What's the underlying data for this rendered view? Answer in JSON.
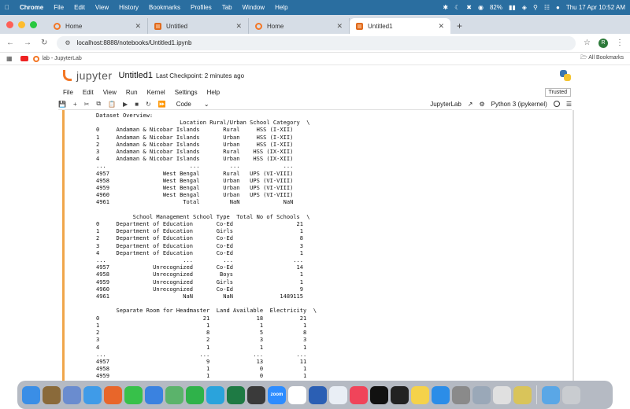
{
  "macos_menubar": {
    "app_name": "Chrome",
    "menus": [
      "File",
      "Edit",
      "View",
      "History",
      "Bookmarks",
      "Profiles",
      "Tab",
      "Window",
      "Help"
    ],
    "battery": "82%",
    "datetime": "Thu 17 Apr  10:52 AM"
  },
  "browser": {
    "tabs": [
      {
        "title": "Home",
        "icon": "jupyter-icon",
        "active": false
      },
      {
        "title": "Untitled",
        "icon": "notebook-icon",
        "active": false
      },
      {
        "title": "Home",
        "icon": "jupyter-icon",
        "active": false
      },
      {
        "title": "Untitled1",
        "icon": "notebook-icon",
        "active": true
      }
    ],
    "url": "localhost:8888/notebooks/Untitled1.ipynb",
    "profile_initial": "R",
    "bookmarks": [
      {
        "label": "",
        "icon": "youtube-icon"
      },
      {
        "label": "lab - JupyterLab",
        "icon": "jupyter-icon"
      }
    ],
    "all_bookmarks": "All Bookmarks"
  },
  "jupyter": {
    "logo_text": "jupyter",
    "notebook_title": "Untitled1",
    "checkpoint": "Last Checkpoint: 2 minutes ago",
    "menu": [
      "File",
      "Edit",
      "View",
      "Run",
      "Kernel",
      "Settings",
      "Help"
    ],
    "trusted": "Trusted",
    "cell_type": "Code",
    "jupyterlab_link": "JupyterLab",
    "kernel": "Python 3 (ipykernel)"
  },
  "output_lines": [
    "Dataset Overview:",
    "                         Location Rural/Urban School Category  \\",
    "0     Andaman & Nicobar Islands       Rural     HSS (I-XII)",
    "1     Andaman & Nicobar Islands       Urban     HSS (I-XII)",
    "2     Andaman & Nicobar Islands       Urban     HSS (I-XII)",
    "3     Andaman & Nicobar Islands       Rural    HSS (IX-XII)",
    "4     Andaman & Nicobar Islands       Urban    HSS (IX-XII)",
    "...                         ...         ...             ...",
    "4957                West Bengal       Rural   UPS (VI-VIII)",
    "4958                West Bengal       Urban   UPS (VI-VIII)",
    "4959                West Bengal       Urban   UPS (VI-VIII)",
    "4960                West Bengal       Urban   UPS (VI-VIII)",
    "4961                      Total         NaN             NaN",
    "",
    "           School Management School Type  Total No of Schools  \\",
    "0     Department of Education       Co-Ed                   21",
    "1     Department of Education       Girls                    1",
    "2     Department of Education       Co-Ed                    8",
    "3     Department of Education       Co-Ed                    3",
    "4     Department of Education       Co-Ed                    1",
    "...                       ...         ...                  ...",
    "4957             Unrecognized       Co-Ed                   14",
    "4958             Unrecognized        Boys                    1",
    "4959             Unrecognized       Girls                    1",
    "4960             Unrecognized       Co-Ed                    9",
    "4961                      NaN         NaN              1489115",
    "",
    "      Separate Room for Headmaster  Land Available  Electricity  \\",
    "0                               21              18           21",
    "1                                1               1            1",
    "2                                8               5            8",
    "3                                2               3            3",
    "4                                1               1            1",
    "...                            ...             ...          ...",
    "4957                             9              13           11",
    "4958                             1               0            1",
    "4959                             1               0            1"
  ],
  "dock_apps": [
    {
      "name": "finder-icon",
      "color": "#3a8ee6",
      "label": ""
    },
    {
      "name": "launchpad-icon",
      "color": "#8a6a3a",
      "label": ""
    },
    {
      "name": "apps-grid-icon",
      "color": "#6a8ccf",
      "label": ""
    },
    {
      "name": "safari-icon",
      "color": "#3f9be8",
      "label": ""
    },
    {
      "name": "firefox-icon",
      "color": "#e8662a",
      "label": ""
    },
    {
      "name": "messages-icon",
      "color": "#37c14a",
      "label": ""
    },
    {
      "name": "mail-icon",
      "color": "#3a82e0",
      "label": ""
    },
    {
      "name": "maps-icon",
      "color": "#5bb36b",
      "label": ""
    },
    {
      "name": "facetime-icon",
      "color": "#2fb24a",
      "label": ""
    },
    {
      "name": "telegram-icon",
      "color": "#2aa3dc",
      "label": ""
    },
    {
      "name": "excel-icon",
      "color": "#1e7a44",
      "label": ""
    },
    {
      "name": "terminal-alt-icon",
      "color": "#3a3a3a",
      "label": ""
    },
    {
      "name": "zoom-icon",
      "color": "#2d8cff",
      "label": "zoom"
    },
    {
      "name": "calendar-icon",
      "color": "#ffffff",
      "label": ""
    },
    {
      "name": "word-icon",
      "color": "#2b5fb4",
      "label": ""
    },
    {
      "name": "freeform-icon",
      "color": "#e9eef5",
      "label": ""
    },
    {
      "name": "music-icon",
      "color": "#f0445a",
      "label": ""
    },
    {
      "name": "appletv-icon",
      "color": "#111111",
      "label": ""
    },
    {
      "name": "terminal-icon",
      "color": "#222222",
      "label": ""
    },
    {
      "name": "notes-icon",
      "color": "#f5d24a",
      "label": ""
    },
    {
      "name": "appstore-icon",
      "color": "#2b8de8",
      "label": ""
    },
    {
      "name": "settings-icon",
      "color": "#8a8a8a",
      "label": ""
    },
    {
      "name": "preview-icon",
      "color": "#9aa8b8",
      "label": ""
    },
    {
      "name": "chrome-icon",
      "color": "#e0e0e0",
      "label": ""
    },
    {
      "name": "python-launcher-icon",
      "color": "#d9c45a",
      "label": ""
    },
    {
      "name": "folder-icon",
      "color": "#5aa7e6",
      "label": ""
    },
    {
      "name": "trash-icon",
      "color": "#c9ccd0",
      "label": ""
    }
  ]
}
